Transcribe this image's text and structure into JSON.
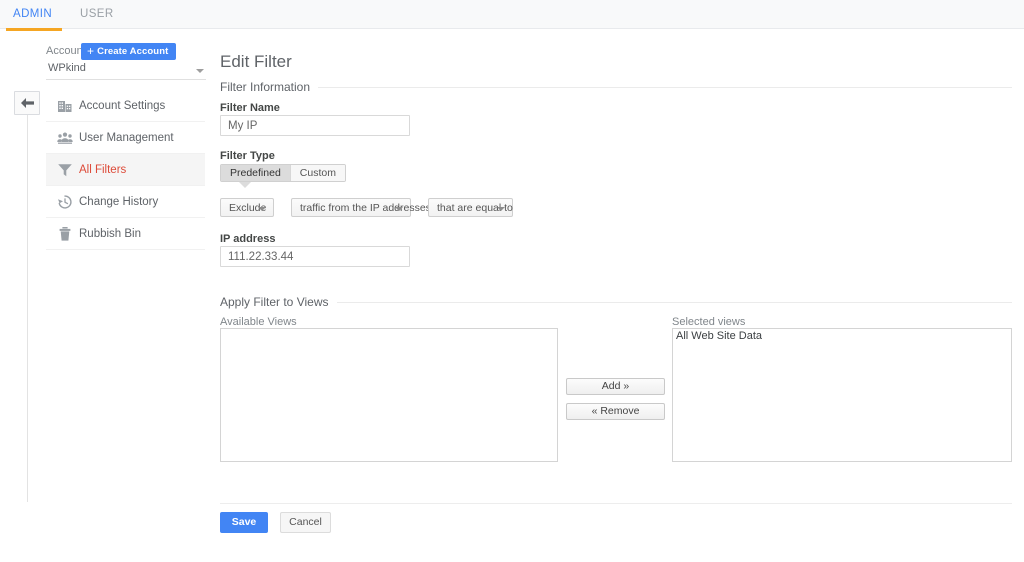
{
  "tabs": [
    {
      "label": "ADMIN",
      "active": true
    },
    {
      "label": "USER",
      "active": false
    }
  ],
  "accent": {
    "tab_active": "#4285f4",
    "tab_underline": "#f5a623",
    "nav_active_text": "#dd4b39",
    "primary_button": "#4285f4"
  },
  "account": {
    "label": "Account",
    "create_button": "Create Account",
    "selected": "WPkind"
  },
  "sidebar": {
    "collapse_icon": "back-arrow-icon",
    "items": [
      {
        "label": "Account Settings",
        "icon": "building-icon",
        "active": false
      },
      {
        "label": "User Management",
        "icon": "people-icon",
        "active": false
      },
      {
        "label": "All Filters",
        "icon": "funnel-icon",
        "active": true
      },
      {
        "label": "Change History",
        "icon": "history-clock-icon",
        "active": false
      },
      {
        "label": "Rubbish Bin",
        "icon": "trash-icon",
        "active": false
      }
    ]
  },
  "main": {
    "title": "Edit Filter",
    "filter_information": {
      "section_label": "Filter Information",
      "name_label": "Filter Name",
      "name_value": "My IP",
      "type_label": "Filter Type",
      "type_options": [
        {
          "label": "Predefined",
          "selected": true
        },
        {
          "label": "Custom",
          "selected": false
        }
      ],
      "dropdowns": [
        {
          "name": "filter-verb",
          "value": "Exclude"
        },
        {
          "name": "filter-source",
          "value": "traffic from the IP addresses"
        },
        {
          "name": "filter-match",
          "value": "that are equal to"
        }
      ],
      "ip_label": "IP address",
      "ip_value": "111.22.33.44"
    },
    "apply_to_views": {
      "section_label": "Apply Filter to Views",
      "available_label": "Available Views",
      "available_items": [],
      "selected_label": "Selected views",
      "selected_items": [
        "All Web Site Data"
      ],
      "add_button": "Add »",
      "remove_button": "« Remove"
    },
    "actions": {
      "save": "Save",
      "cancel": "Cancel"
    }
  }
}
